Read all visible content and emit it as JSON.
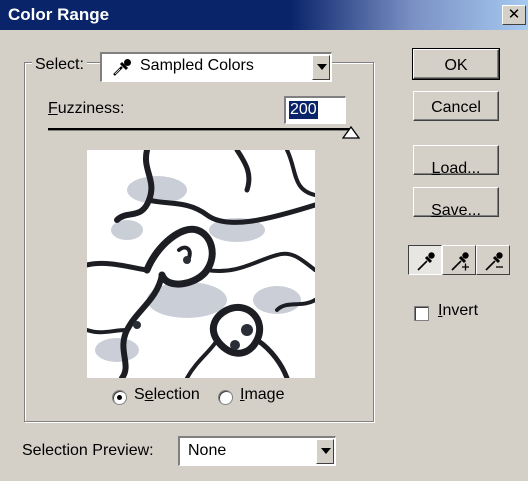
{
  "window": {
    "title": "Color Range",
    "close_glyph": "✕"
  },
  "select": {
    "label": "Select:",
    "label_underline": "S",
    "value": "Sampled Colors",
    "icon": "eyedropper-icon"
  },
  "fuzziness": {
    "label_first": "F",
    "label_rest": "uzziness:",
    "value": "200",
    "slider_fraction": 1.0
  },
  "preview_mode": {
    "selection_pre": "S",
    "selection_u": "e",
    "selection_post": "lection",
    "image_u": "I",
    "image_post": "mage",
    "selected": "selection"
  },
  "buttons": {
    "ok": "OK",
    "cancel": "Cancel",
    "load_u": "L",
    "load_rest": "oad...",
    "save_u": "S",
    "save_rest": "ave..."
  },
  "invert": {
    "label_u": "I",
    "label_rest": "nvert",
    "checked": false
  },
  "selection_preview": {
    "label": "Selection Preview:",
    "value": "None"
  },
  "eyedroppers": [
    "eyedropper-icon",
    "eyedropper-plus-icon",
    "eyedropper-minus-icon"
  ],
  "colors": {
    "titlebar": "#0a246a",
    "face": "#d4d0c8",
    "highlight": "#0a246a"
  }
}
